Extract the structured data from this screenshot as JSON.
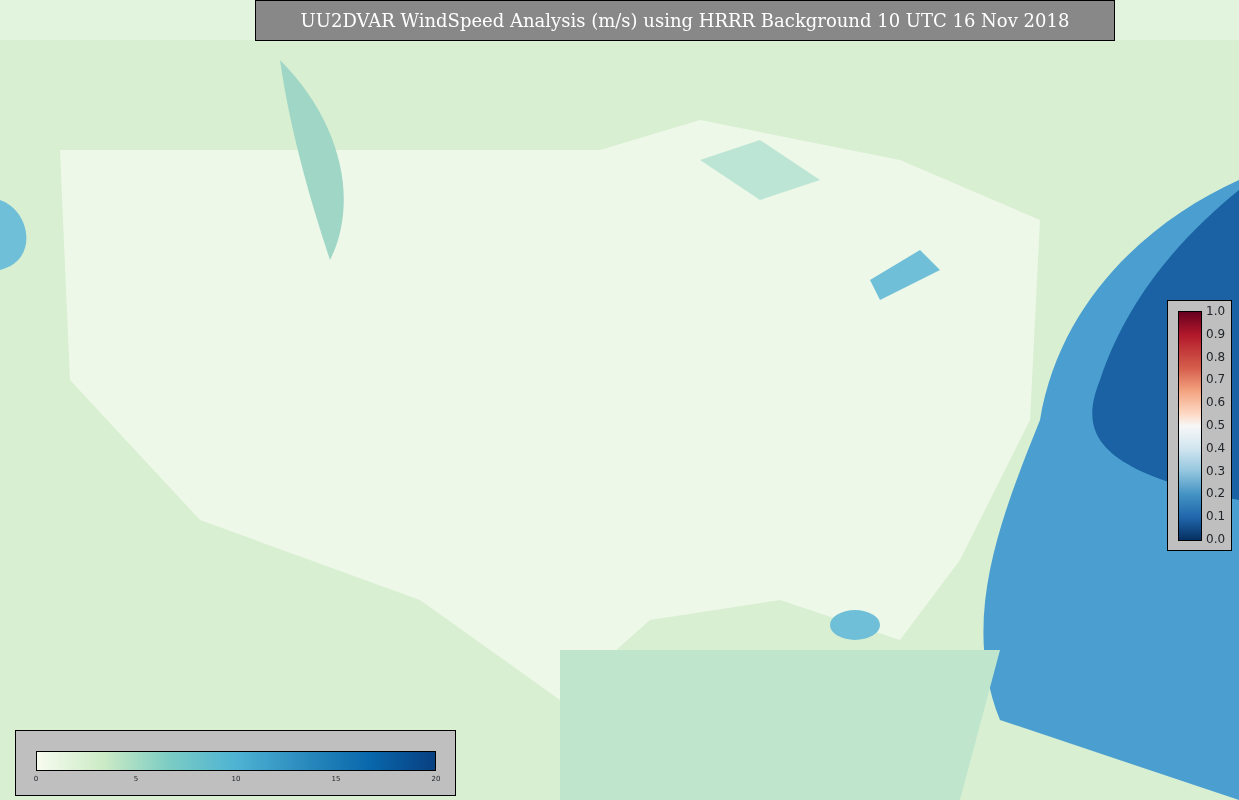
{
  "title": "UU2DVAR WindSpeed Analysis (m/s) using HRRR Background 10 UTC 16 Nov 2018",
  "observation_colorbar": {
    "ticks": [
      "1.0",
      "0.9",
      "0.8",
      "0.7",
      "0.6",
      "0.5",
      "0.4",
      "0.3",
      "0.2",
      "0.1",
      "0.0"
    ]
  },
  "windspeed_colorbar": {
    "ticks": [
      "0",
      "5",
      "10",
      "15",
      "20"
    ]
  }
}
